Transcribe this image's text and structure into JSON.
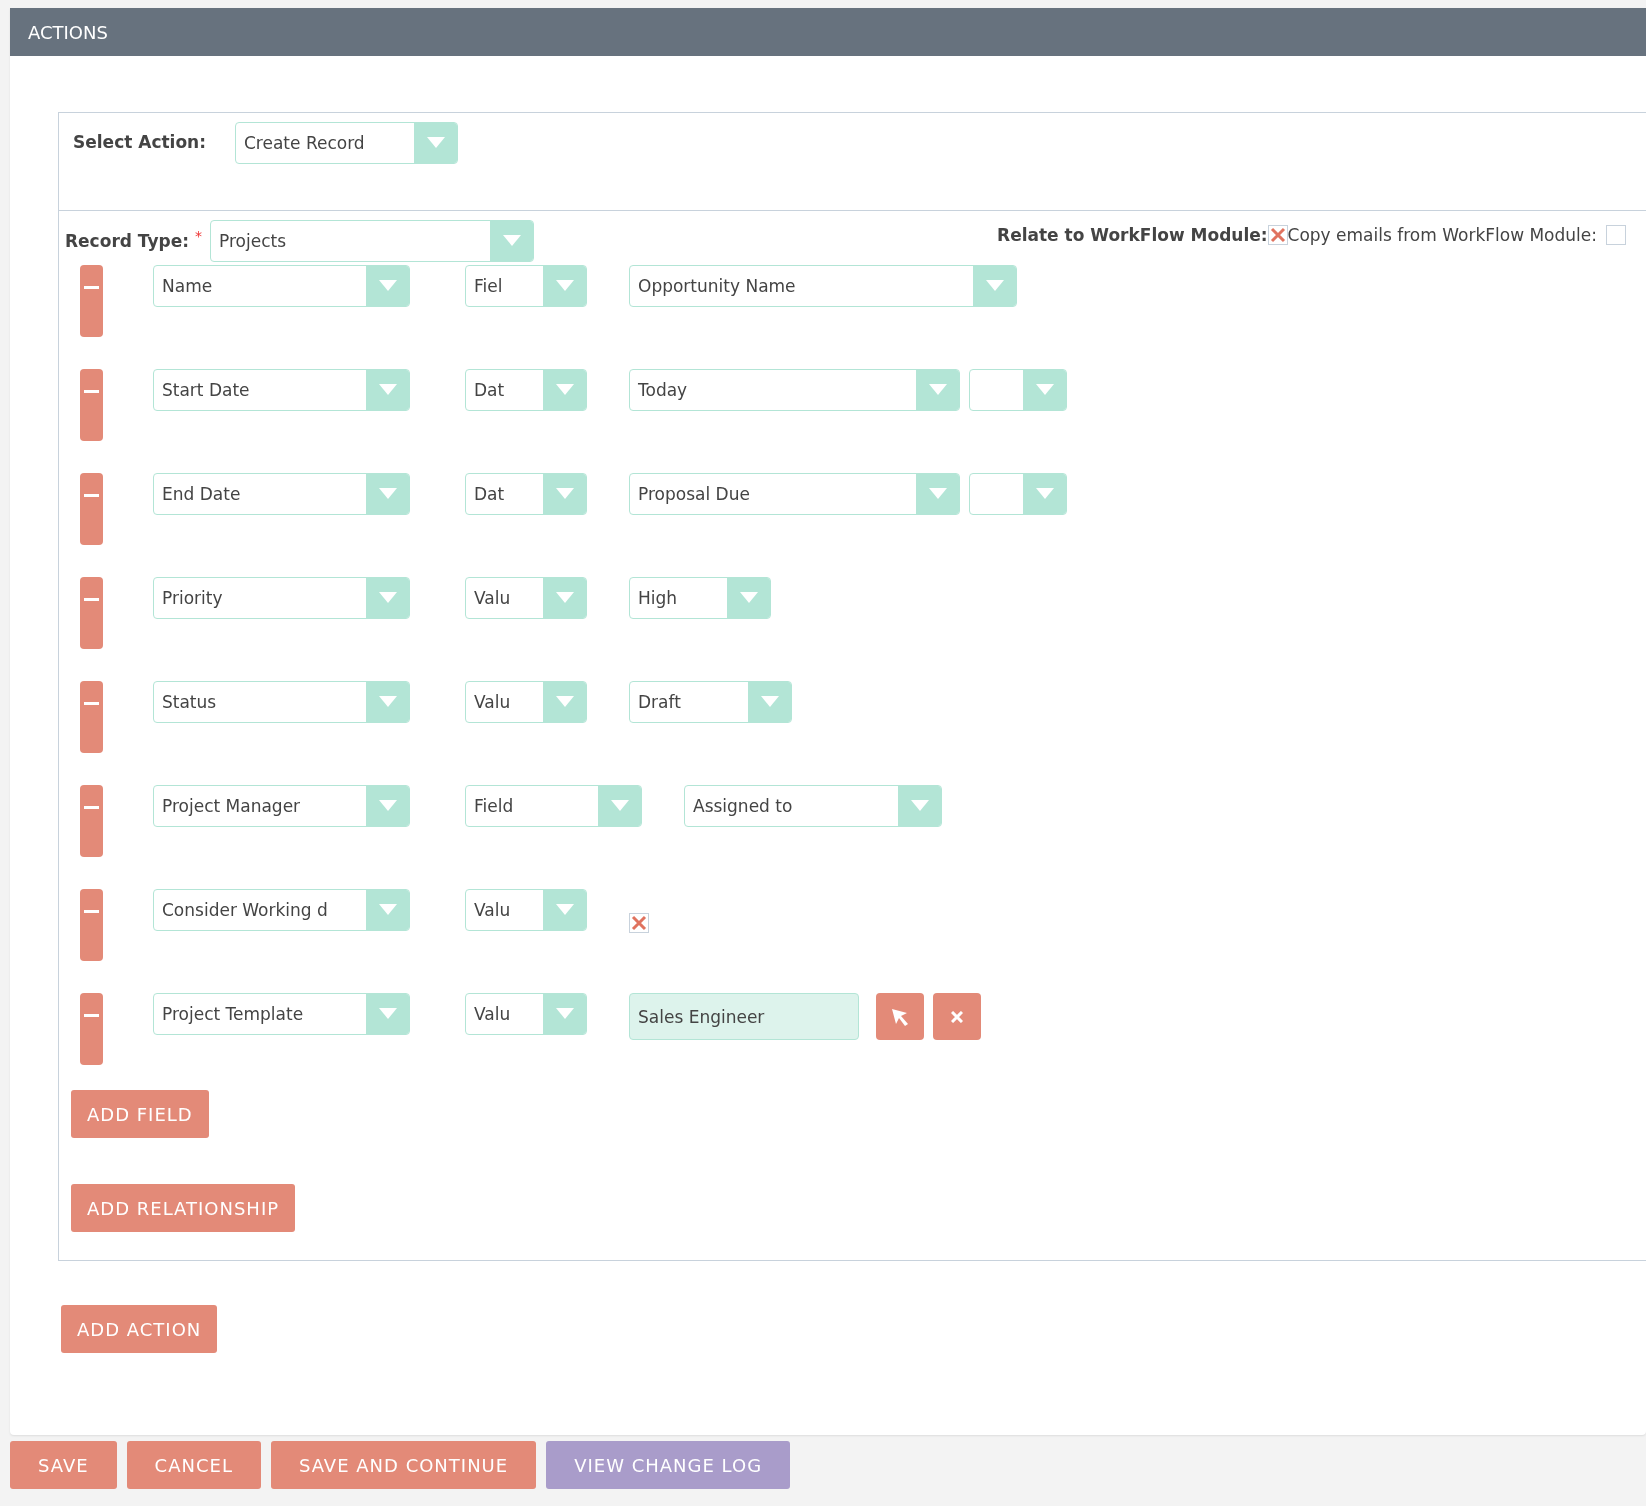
{
  "section": {
    "title": "ACTIONS"
  },
  "select_action": {
    "label": "Select Action:",
    "value": "Create Record"
  },
  "record_type": {
    "label": "Record Type:",
    "required_mark": "*",
    "value": "Projects"
  },
  "relate_to_workflow": {
    "label": "Relate to WorkFlow Module:",
    "checked": true
  },
  "copy_emails": {
    "label": "Copy emails from WorkFlow Module:",
    "checked": false
  },
  "field_rows": [
    {
      "field": "Name",
      "type": "Fiel",
      "value": {
        "kind": "select",
        "text": "Opportunity Name"
      }
    },
    {
      "field": "Start Date",
      "type": "Dat",
      "value": {
        "kind": "date",
        "text": "Today"
      }
    },
    {
      "field": "End Date",
      "type": "Dat",
      "value": {
        "kind": "date",
        "text": "Proposal Due"
      }
    },
    {
      "field": "Priority",
      "type": "Valu",
      "value": {
        "kind": "select",
        "text": "High"
      }
    },
    {
      "field": "Status",
      "type": "Valu",
      "value": {
        "kind": "select",
        "text": "Draft"
      }
    },
    {
      "field": "Project Manager",
      "type": "Field",
      "value": {
        "kind": "select",
        "text": "Assigned to"
      }
    },
    {
      "field": "Consider Working d",
      "type": "Valu",
      "value": {
        "kind": "checkbox",
        "checked": true
      }
    },
    {
      "field": "Project Template",
      "type": "Valu",
      "value": {
        "kind": "relate",
        "text": "Sales Engineer"
      }
    }
  ],
  "panel_buttons": [
    "ADD FIELD",
    "ADD RELATIONSHIP"
  ],
  "add_action_button": "ADD ACTION",
  "footer_buttons": [
    {
      "label": "SAVE",
      "kind": "primary"
    },
    {
      "label": "CANCEL",
      "kind": "primary"
    },
    {
      "label": "SAVE AND CONTINUE",
      "kind": "primary"
    },
    {
      "label": "VIEW CHANGE LOG",
      "kind": "secondary"
    }
  ]
}
